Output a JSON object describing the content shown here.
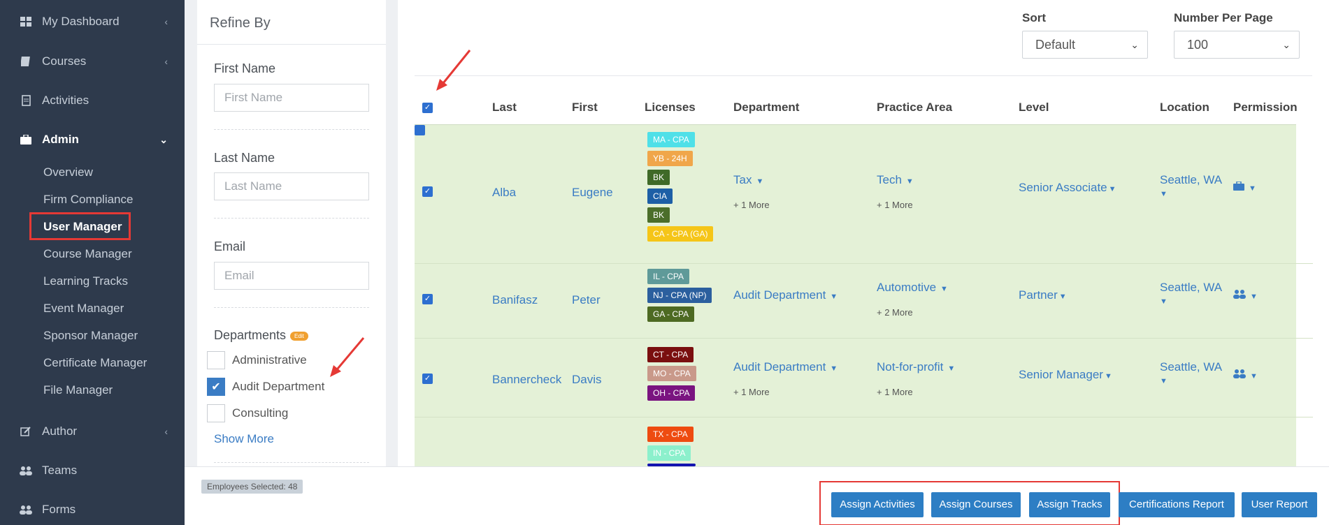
{
  "sidebar": {
    "items": [
      {
        "label": "My Dashboard",
        "icon": "dashboard-icon"
      },
      {
        "label": "Courses",
        "icon": "book-icon"
      },
      {
        "label": "Activities",
        "icon": "document-icon"
      },
      {
        "label": "Admin",
        "icon": "briefcase-icon"
      },
      {
        "label": "Author",
        "icon": "edit-icon"
      },
      {
        "label": "Teams",
        "icon": "users-icon"
      },
      {
        "label": "Forms",
        "icon": "users-icon"
      }
    ],
    "admin_sub": [
      "Overview",
      "Firm Compliance",
      "User Manager",
      "Course Manager",
      "Learning Tracks",
      "Event Manager",
      "Sponsor Manager",
      "Certificate Manager",
      "File Manager"
    ]
  },
  "refine": {
    "title": "Refine By",
    "first_name": {
      "label": "First Name",
      "placeholder": "First Name"
    },
    "last_name": {
      "label": "Last Name",
      "placeholder": "Last Name"
    },
    "email": {
      "label": "Email",
      "placeholder": "Email"
    },
    "departments": {
      "label": "Departments",
      "edit_badge": "Edit",
      "options": [
        {
          "label": "Administrative",
          "checked": false
        },
        {
          "label": "Audit Department",
          "checked": true
        },
        {
          "label": "Consulting",
          "checked": false
        }
      ],
      "show_more": "Show More"
    }
  },
  "controls": {
    "sort_label": "Sort",
    "sort_value": "Default",
    "per_page_label": "Number Per Page",
    "per_page_value": "100"
  },
  "table": {
    "headers": [
      "Last",
      "First",
      "Licenses",
      "Department",
      "Practice Area",
      "Level",
      "Location",
      "Permission"
    ],
    "rows": [
      {
        "last": "Alba",
        "first": "Eugene",
        "licenses": [
          {
            "text": "MA - CPA",
            "color": "#4fe0e8"
          },
          {
            "text": "YB - 24H",
            "color": "#f0a64a"
          },
          {
            "text": "BK",
            "color": "#3f6a28"
          },
          {
            "text": "CIA",
            "color": "#1d5fa6"
          },
          {
            "text": "BK",
            "color": "#4b6e2a"
          },
          {
            "text": "CA - CPA (GA)",
            "color": "#f5c518"
          }
        ],
        "department": "Tax",
        "department_more": "+ 1 More",
        "practice": "Tech",
        "practice_more": "+ 1 More",
        "level": "Senior Associate",
        "location": "Seattle, WA",
        "permission_icon": "briefcase-icon"
      },
      {
        "last": "Banifasz",
        "first": "Peter",
        "licenses": [
          {
            "text": "IL - CPA",
            "color": "#5f9a99"
          },
          {
            "text": "NJ - CPA (NP)",
            "color": "#2b5f9e"
          },
          {
            "text": "GA - CPA",
            "color": "#4d6a22"
          }
        ],
        "department": "Audit Department",
        "department_more": "",
        "practice": "Automotive",
        "practice_more": "+ 2 More",
        "level": "Partner",
        "location": "Seattle, WA",
        "permission_icon": "users-icon"
      },
      {
        "last": "Bannercheck",
        "first": "Davis",
        "licenses": [
          {
            "text": "CT - CPA",
            "color": "#7a0f0f"
          },
          {
            "text": "MO - CPA",
            "color": "#c9998a"
          },
          {
            "text": "OH - CPA",
            "color": "#7a1480"
          }
        ],
        "department": "Audit Department",
        "department_more": "+ 1 More",
        "practice": "Not-for-profit",
        "practice_more": "+ 1 More",
        "level": "Senior Manager",
        "location": "Seattle, WA",
        "permission_icon": "users-icon"
      },
      {
        "last": "",
        "first": "",
        "licenses": [
          {
            "text": "TX - CPA",
            "color": "#ee4b10"
          },
          {
            "text": "IN - CPA",
            "color": "#8cf0cc"
          },
          {
            "text": "",
            "color": "#1414b0"
          }
        ]
      }
    ]
  },
  "bottom": {
    "employees_selected": "Employees Selected: 48",
    "buttons": [
      "Assign Activities",
      "Assign Courses",
      "Assign Tracks",
      "Certifications Report",
      "User Report"
    ]
  }
}
